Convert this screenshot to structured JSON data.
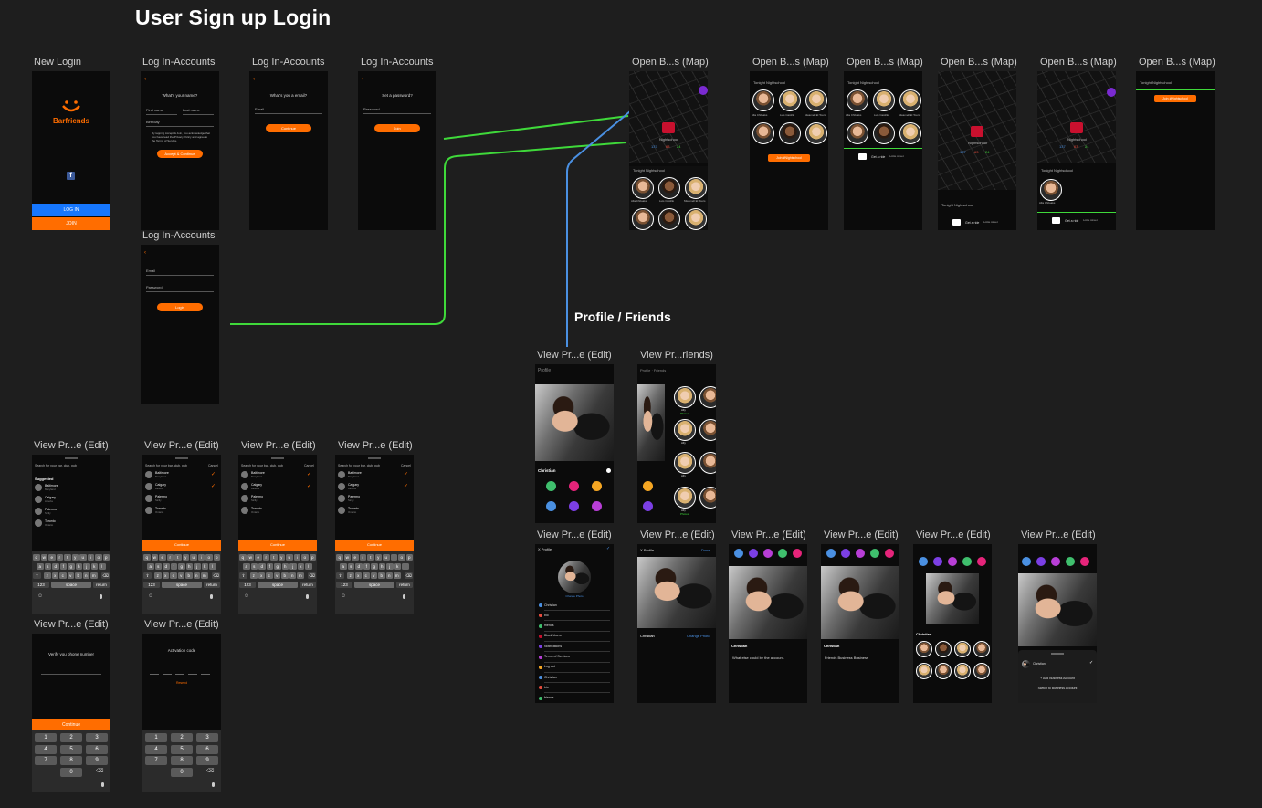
{
  "board": {
    "title": "User Sign up Login",
    "section_profile": "Profile / Friends"
  },
  "labels": {
    "new_login": "New Login",
    "login_accounts": "Log In-Accounts",
    "open_map_a": "Open B...s (Map)",
    "open_map_b": "Open B...s (Map)",
    "view_edit": "View Pr...e (Edit)",
    "view_friends": "View Pr...riends)"
  },
  "screens": {
    "new_login": {
      "brand": "Barfriends",
      "login_button": "LOG IN",
      "join_button": "JOIN"
    },
    "name": {
      "title": "What's your name?",
      "first_name": "First name",
      "last_name": "Last name",
      "birthday": "Birthday",
      "terms": "By tapping Accept & Join, you acknowledge that you have read the Privacy Policy and agree to the Terms of Service.",
      "button": "Accept & Continue"
    },
    "email": {
      "title": "What's you a email?",
      "field": "Email",
      "button": "Continue"
    },
    "password": {
      "title": "Set a password?",
      "field": "Password",
      "button": "Join"
    },
    "login": {
      "email": "Email",
      "password": "Password",
      "button": "Login"
    },
    "map": {
      "tonight": "Tonight",
      "venue": "Nightschool",
      "stats": [
        "137",
        "63",
        "24"
      ],
      "ride_label": "Get a ride",
      "ride_detail": "Lottie street",
      "join_button": "Join #Nightschool",
      "people": [
        "Alla Chiloaks",
        "Luis Castillo",
        "Mwamell El Tours",
        "Alla Chiloaks",
        "Luis Castillo",
        "Mwamell El Tours"
      ]
    },
    "search": {
      "placeholder": "Search for your bar, club, pub",
      "cancel": "Cancel",
      "suggested": "Suggested",
      "cities": [
        {
          "name": "Baltimore",
          "sub": "Maryland"
        },
        {
          "name": "Calgary",
          "sub": "Alberta"
        },
        {
          "name": "Palermo",
          "sub": "Sicily"
        },
        {
          "name": "Toronto",
          "sub": "Ontario"
        }
      ],
      "continue": "Continue",
      "kb_row1": [
        "q",
        "w",
        "e",
        "r",
        "t",
        "y",
        "u",
        "i",
        "o",
        "p"
      ],
      "kb_row2": [
        "a",
        "s",
        "d",
        "f",
        "g",
        "h",
        "j",
        "k",
        "l"
      ],
      "kb_row3": [
        "z",
        "x",
        "c",
        "v",
        "b",
        "n",
        "m"
      ],
      "kb_123": "123",
      "kb_space": "space",
      "kb_return": "return"
    },
    "verify": {
      "title": "Verify you phone number",
      "button": "Continue",
      "activation_title": "Activation code",
      "resend": "Resend",
      "keypad": [
        "1",
        "2",
        "3",
        "4",
        "5",
        "6",
        "7",
        "8",
        "9",
        "0"
      ]
    },
    "profile": {
      "header": "Profile",
      "header_sub": "Friends",
      "name": "Christian",
      "change_photo": "Change Photo",
      "done": "Done",
      "close": "X Profile",
      "bio_prompt": "What else could be the account.",
      "friends_row": "Friends  Business Business",
      "add_business": "+ Add Business Account",
      "switch_business": "Switch to Business Account",
      "menu": [
        "Christian",
        "bio",
        "friends",
        "Block Users",
        "Notifications",
        "Terms of Services",
        "Log out",
        "Christian",
        "bio",
        "friends"
      ],
      "friend_name": "Ally",
      "friend_sub": "Photos"
    }
  },
  "colors": {
    "accent": "#ff6d00",
    "blue_button": "#1677ff",
    "connector_green": "#3fd93a",
    "connector_blue": "#4a90e2",
    "canvas": "#1e1e1e"
  }
}
